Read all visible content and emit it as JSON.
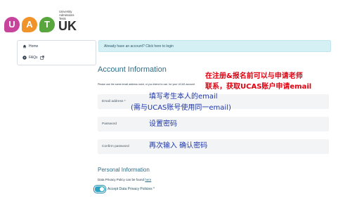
{
  "logo": {
    "letters": [
      {
        "char": "U",
        "color": "#c8439b"
      },
      {
        "char": "A",
        "color": "#f0932a"
      },
      {
        "char": "T",
        "color": "#5aa63e"
      }
    ],
    "tagline_line1": "University",
    "tagline_line2": "Admissions",
    "tagline_line3": "Tests",
    "wordmark": "UK"
  },
  "sidebar": {
    "items": [
      {
        "label": "Home",
        "icon": "home-icon"
      },
      {
        "label": "FAQs",
        "icon": "question-circle-icon",
        "suffix_icon": "external-link-icon"
      }
    ]
  },
  "notice": {
    "text": "Already have an account? Click here to login"
  },
  "account": {
    "heading": "Account Information",
    "help_text": "Please use the same email address used, or you intend to use, for your UCAS account",
    "fields": {
      "email": {
        "label": "Email address *"
      },
      "password": {
        "label": "Password"
      },
      "confirm": {
        "label": "Confirm password"
      }
    }
  },
  "personal": {
    "heading": "Personal Information",
    "privacy_text": "Data Privacy Policy can be found ",
    "privacy_link": "here",
    "toggle_label": "Accept Data Privacy Policies *",
    "toggle_on": true
  },
  "annotations": {
    "red_line1": "在注册&报名前可以与申请老师",
    "red_line2": "联系，获取UCAS账户申请email",
    "email_line1": "填写考生本人的email",
    "email_line2": "(需与UCAS账号使用同一email)",
    "password": "设置密码",
    "confirm": "再次输入 确认密码"
  },
  "colors": {
    "accent": "#2f6e88",
    "notice_bg": "#d5f0f5",
    "field_bg": "#f2f4f5",
    "annotation_red": "#e00010",
    "annotation_blue": "#2138a8"
  }
}
